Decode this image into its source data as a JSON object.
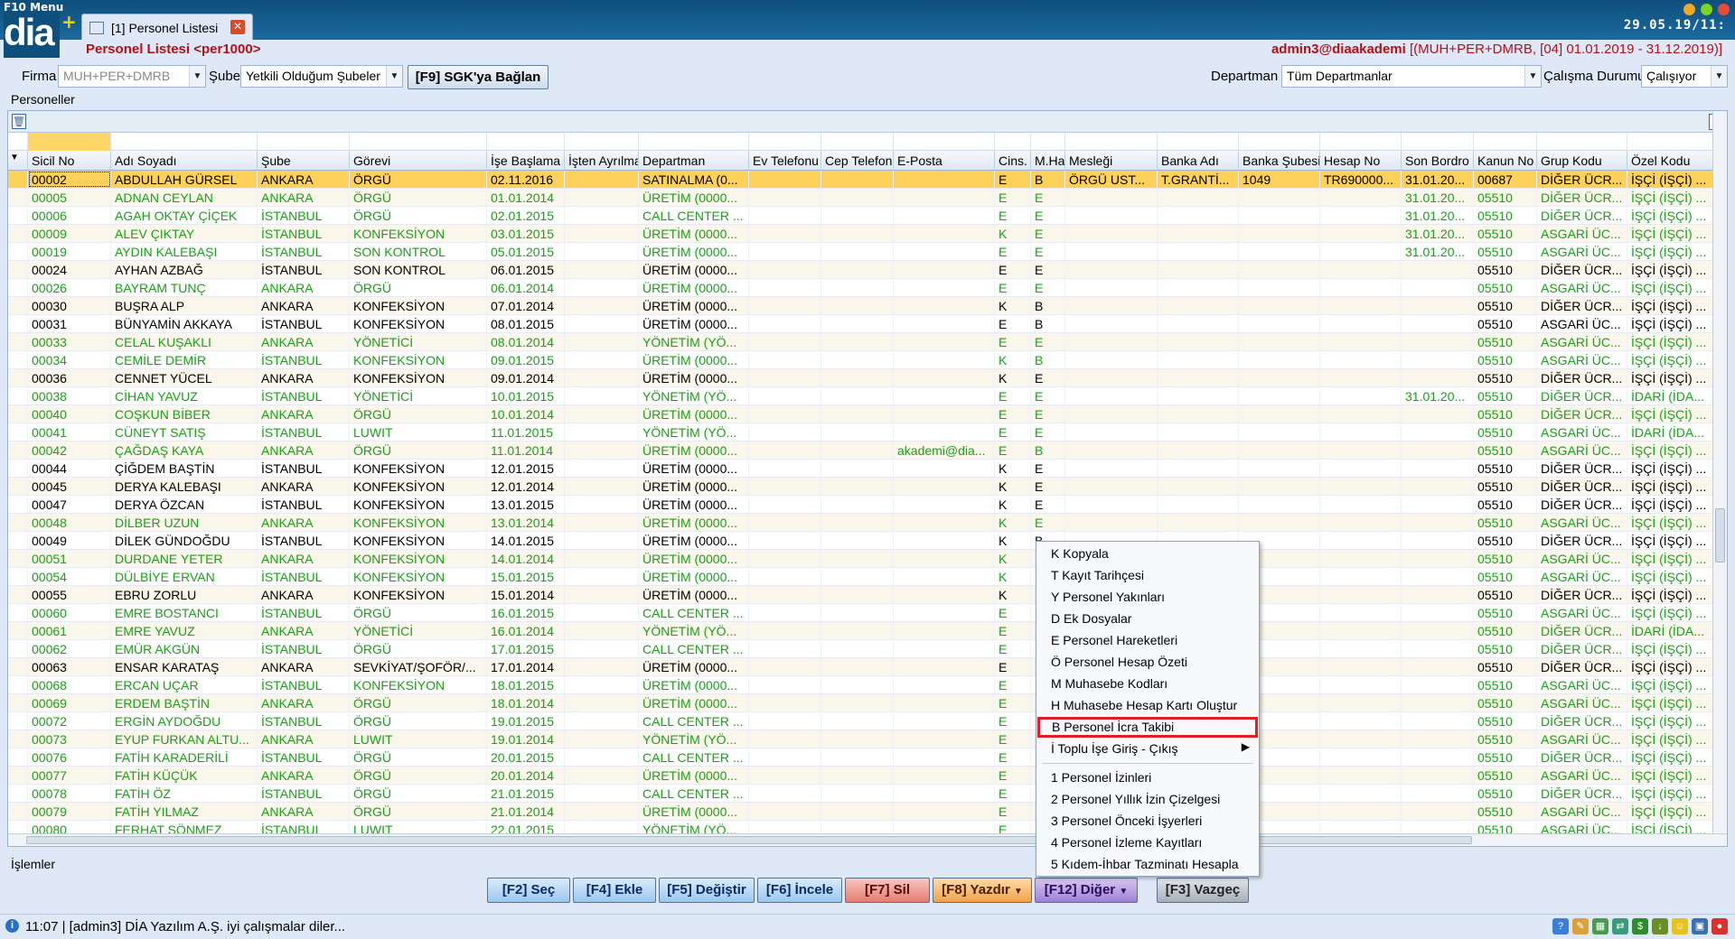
{
  "app": {
    "menu_label": "F10 Menu",
    "logo": "dia",
    "tab_label": "[1] Personel Listesi",
    "clock": "29.05.19/11:"
  },
  "title": {
    "left": "Personel Listesi <per1000>",
    "right_user": "admin3@diaakademi",
    "right_period": " [(MUH+PER+DMRB, [04] 01.01.2019 - 31.12.2019)]"
  },
  "filters": {
    "firma_label": "Firma",
    "firma_value": "MUH+PER+DMRB",
    "sube_label": "Şube",
    "sube_value": "Yetkili Olduğum Şubeler",
    "sgk_button": "[F9] SGK'ya Bağlan",
    "departman_label": "Departman",
    "departman_value": "Tüm Departmanlar",
    "calisma_label": "Çalışma Durumu",
    "calisma_value": "Çalışıyor"
  },
  "section_personeller": "Personeller",
  "section_islemler": "İşlemler",
  "columns": [
    "Sicil No",
    "Adı Soyadı",
    "Şube",
    "Görevi",
    "İşe Başlama",
    "İşten Ayrılma",
    "Departman",
    "Ev Telefonu",
    "Cep Telefonu",
    "E-Posta",
    "Cins.",
    "M.Hal",
    "Mesleği",
    "Banka Adı",
    "Banka Şubesi",
    "Hesap No",
    "Son Bordro",
    "Kanun No",
    "Grup Kodu",
    "Özel Kodu"
  ],
  "rows": [
    [
      "00002",
      "ABDULLAH GÜRSEL",
      "ANKARA",
      "ÖRGÜ",
      "02.11.2016",
      "",
      "SATINALMA (0...",
      "",
      "",
      "",
      "E",
      "B",
      "ÖRGÜ UST...",
      "T.GRANTİ...",
      "1049",
      "TR690000...",
      "31.01.20...",
      "00687",
      "DİĞER ÜCR...",
      "İŞÇİ (İŞÇİ) ...",
      "s"
    ],
    [
      "00005",
      "ADNAN CEYLAN",
      "ANKARA",
      "ÖRGÜ",
      "01.01.2014",
      "",
      "ÜRETİM (0000...",
      "",
      "",
      "",
      "E",
      "E",
      "",
      "",
      "",
      "",
      "31.01.20...",
      "05510",
      "DİĞER ÜCR...",
      "İŞÇİ (İŞÇİ) ...",
      "g"
    ],
    [
      "00006",
      "AGAH OKTAY ÇİÇEK",
      "İSTANBUL",
      "ÖRGÜ",
      "02.01.2015",
      "",
      "CALL CENTER ...",
      "",
      "",
      "",
      "E",
      "E",
      "",
      "",
      "",
      "",
      "31.01.20...",
      "05510",
      "DİĞER ÜCR...",
      "İŞÇİ (İŞÇİ) ...",
      "g"
    ],
    [
      "00009",
      "ALEV ÇIKTAY",
      "İSTANBUL",
      "KONFEKSİYON",
      "03.01.2015",
      "",
      "ÜRETİM (0000...",
      "",
      "",
      "",
      "K",
      "E",
      "",
      "",
      "",
      "",
      "31.01.20...",
      "05510",
      "ASGARİ ÜC...",
      "İŞÇİ (İŞÇİ) ...",
      "g"
    ],
    [
      "00019",
      "AYDIN KALEBAŞI",
      "İSTANBUL",
      "SON KONTROL",
      "05.01.2015",
      "",
      "ÜRETİM (0000...",
      "",
      "",
      "",
      "E",
      "E",
      "",
      "",
      "",
      "",
      "31.01.20...",
      "05510",
      "ASGARİ ÜC...",
      "İŞÇİ (İŞÇİ) ...",
      "g"
    ],
    [
      "00024",
      "AYHAN AZBAĞ",
      "İSTANBUL",
      "SON KONTROL",
      "06.01.2015",
      "",
      "ÜRETİM (0000...",
      "",
      "",
      "",
      "E",
      "E",
      "",
      "",
      "",
      "",
      "",
      "05510",
      "DİĞER ÜCR...",
      "İŞÇİ (İŞÇİ) ...",
      "b"
    ],
    [
      "00026",
      "BAYRAM TUNÇ",
      "ANKARA",
      "ÖRGÜ",
      "06.01.2014",
      "",
      "ÜRETİM (0000...",
      "",
      "",
      "",
      "E",
      "E",
      "",
      "",
      "",
      "",
      "",
      "05510",
      "ASGARİ ÜC...",
      "İŞÇİ (İŞÇİ) ...",
      "g"
    ],
    [
      "00030",
      "BUŞRA ALP",
      "ANKARA",
      "KONFEKSİYON",
      "07.01.2014",
      "",
      "ÜRETİM (0000...",
      "",
      "",
      "",
      "K",
      "B",
      "",
      "",
      "",
      "",
      "",
      "05510",
      "DİĞER ÜCR...",
      "İŞÇİ (İŞÇİ) ...",
      "b"
    ],
    [
      "00031",
      "BÜNYAMİN AKKAYA",
      "İSTANBUL",
      "KONFEKSİYON",
      "08.01.2015",
      "",
      "ÜRETİM (0000...",
      "",
      "",
      "",
      "E",
      "B",
      "",
      "",
      "",
      "",
      "",
      "05510",
      "ASGARİ ÜC...",
      "İŞÇİ (İŞÇİ) ...",
      "b"
    ],
    [
      "00033",
      "CELAL KUŞAKLI",
      "ANKARA",
      "YÖNETİCİ",
      "08.01.2014",
      "",
      "YÖNETİM (YÖ...",
      "",
      "",
      "",
      "E",
      "E",
      "",
      "",
      "",
      "",
      "",
      "05510",
      "ASGARİ ÜC...",
      "İŞÇİ (İŞÇİ) ...",
      "g"
    ],
    [
      "00034",
      "CEMİLE DEMİR",
      "İSTANBUL",
      "KONFEKSİYON",
      "09.01.2015",
      "",
      "ÜRETİM (0000...",
      "",
      "",
      "",
      "K",
      "B",
      "",
      "",
      "",
      "",
      "",
      "05510",
      "ASGARİ ÜC...",
      "İŞÇİ (İŞÇİ) ...",
      "g"
    ],
    [
      "00036",
      "CENNET YÜCEL",
      "ANKARA",
      "KONFEKSİYON",
      "09.01.2014",
      "",
      "ÜRETİM (0000...",
      "",
      "",
      "",
      "K",
      "E",
      "",
      "",
      "",
      "",
      "",
      "05510",
      "DİĞER ÜCR...",
      "İŞÇİ (İŞÇİ) ...",
      "b"
    ],
    [
      "00038",
      "CİHAN YAVUZ",
      "İSTANBUL",
      "YÖNETİCİ",
      "10.01.2015",
      "",
      "YÖNETİM (YÖ...",
      "",
      "",
      "",
      "E",
      "E",
      "",
      "",
      "",
      "",
      "31.01.20...",
      "05510",
      "DİĞER ÜCR...",
      "İDARİ (İDA...",
      "g"
    ],
    [
      "00040",
      "COŞKUN BİBER",
      "ANKARA",
      "ÖRGÜ",
      "10.01.2014",
      "",
      "ÜRETİM (0000...",
      "",
      "",
      "",
      "E",
      "E",
      "",
      "",
      "",
      "",
      "",
      "05510",
      "DİĞER ÜCR...",
      "İŞÇİ (İŞÇİ) ...",
      "g"
    ],
    [
      "00041",
      "CÜNEYT SATIŞ",
      "İSTANBUL",
      "LUWIT",
      "11.01.2015",
      "",
      "YÖNETİM (YÖ...",
      "",
      "",
      "",
      "E",
      "E",
      "",
      "",
      "",
      "",
      "",
      "05510",
      "ASGARİ ÜC...",
      "İDARİ (İDA...",
      "g"
    ],
    [
      "00042",
      "ÇAĞDAŞ KAYA",
      "ANKARA",
      "ÖRGÜ",
      "11.01.2014",
      "",
      "ÜRETİM (0000...",
      "",
      "",
      "akademi@dia...",
      "E",
      "B",
      "",
      "",
      "",
      "",
      "",
      "05510",
      "ASGARİ ÜC...",
      "İŞÇİ (İŞÇİ) ...",
      "g"
    ],
    [
      "00044",
      "ÇİĞDEM BAŞTİN",
      "İSTANBUL",
      "KONFEKSİYON",
      "12.01.2015",
      "",
      "ÜRETİM (0000...",
      "",
      "",
      "",
      "K",
      "E",
      "",
      "",
      "",
      "",
      "",
      "05510",
      "DİĞER ÜCR...",
      "İŞÇİ (İŞÇİ) ...",
      "b"
    ],
    [
      "00045",
      "DERYA KALEBAŞI",
      "ANKARA",
      "KONFEKSİYON",
      "12.01.2014",
      "",
      "ÜRETİM (0000...",
      "",
      "",
      "",
      "K",
      "E",
      "",
      "",
      "",
      "",
      "",
      "05510",
      "DİĞER ÜCR...",
      "İŞÇİ (İŞÇİ) ...",
      "b"
    ],
    [
      "00047",
      "DERYA ÖZCAN",
      "İSTANBUL",
      "KONFEKSİYON",
      "13.01.2015",
      "",
      "ÜRETİM (0000...",
      "",
      "",
      "",
      "K",
      "E",
      "",
      "",
      "",
      "",
      "",
      "05510",
      "DİĞER ÜCR...",
      "İŞÇİ (İŞÇİ) ...",
      "b"
    ],
    [
      "00048",
      "DİLBER UZUN",
      "ANKARA",
      "KONFEKSİYON",
      "13.01.2014",
      "",
      "ÜRETİM (0000...",
      "",
      "",
      "",
      "K",
      "E",
      "",
      "",
      "",
      "",
      "",
      "05510",
      "ASGARİ ÜC...",
      "İŞÇİ (İŞÇİ) ...",
      "g"
    ],
    [
      "00049",
      "DİLEK GÜNDOĞDU",
      "İSTANBUL",
      "KONFEKSİYON",
      "14.01.2015",
      "",
      "ÜRETİM (0000...",
      "",
      "",
      "",
      "K",
      "B",
      "",
      "",
      "",
      "",
      "",
      "05510",
      "DİĞER ÜCR...",
      "İŞÇİ (İŞÇİ) ...",
      "b"
    ],
    [
      "00051",
      "DURDANE YETER",
      "ANKARA",
      "KONFEKSİYON",
      "14.01.2014",
      "",
      "ÜRETİM (0000...",
      "",
      "",
      "",
      "K",
      "E",
      "",
      "",
      "",
      "",
      "",
      "05510",
      "ASGARİ ÜC...",
      "İŞÇİ (İŞÇİ) ...",
      "g"
    ],
    [
      "00054",
      "DÜLBİYE ERVAN",
      "İSTANBUL",
      "KONFEKSİYON",
      "15.01.2015",
      "",
      "ÜRETİM (0000...",
      "",
      "",
      "",
      "K",
      "B",
      "",
      "",
      "",
      "",
      "",
      "05510",
      "ASGARİ ÜC...",
      "İŞÇİ (İŞÇİ) ...",
      "g"
    ],
    [
      "00055",
      "EBRU ZORLU",
      "ANKARA",
      "KONFEKSİYON",
      "15.01.2014",
      "",
      "ÜRETİM (0000...",
      "",
      "",
      "",
      "K",
      "B",
      "",
      "",
      "",
      "",
      "",
      "05510",
      "DİĞER ÜCR...",
      "İŞÇİ (İŞÇİ) ...",
      "b"
    ],
    [
      "00060",
      "EMRE BOSTANCI",
      "İSTANBUL",
      "ÖRGÜ",
      "16.01.2015",
      "",
      "CALL CENTER ...",
      "",
      "",
      "",
      "E",
      "B",
      "",
      "",
      "",
      "",
      "",
      "05510",
      "ASGARİ ÜC...",
      "İŞÇİ (İŞÇİ) ...",
      "g"
    ],
    [
      "00061",
      "EMRE YAVUZ",
      "ANKARA",
      "YÖNETİCİ",
      "16.01.2014",
      "",
      "YÖNETİM (YÖ...",
      "",
      "",
      "",
      "E",
      "E",
      "",
      "",
      "",
      "",
      "",
      "05510",
      "DİĞER ÜCR...",
      "İDARİ (İDA...",
      "g"
    ],
    [
      "00062",
      "EMÜR AKGÜN",
      "İSTANBUL",
      "ÖRGÜ",
      "17.01.2015",
      "",
      "CALL CENTER ...",
      "",
      "",
      "",
      "E",
      "E",
      "",
      "",
      "",
      "",
      "",
      "05510",
      "DİĞER ÜCR...",
      "İŞÇİ (İŞÇİ) ...",
      "g"
    ],
    [
      "00063",
      "ENSAR KARATAŞ",
      "ANKARA",
      "SEVKİYAT/ŞOFÖR/...",
      "17.01.2014",
      "",
      "ÜRETİM (0000...",
      "",
      "",
      "",
      "E",
      "E",
      "",
      "",
      "",
      "",
      "",
      "05510",
      "DİĞER ÜCR...",
      "İŞÇİ (İŞÇİ) ...",
      "b"
    ],
    [
      "00068",
      "ERCAN UÇAR",
      "İSTANBUL",
      "KONFEKSİYON",
      "18.01.2015",
      "",
      "ÜRETİM (0000...",
      "",
      "",
      "",
      "E",
      "E",
      "",
      "",
      "",
      "",
      "",
      "05510",
      "ASGARİ ÜC...",
      "İŞÇİ (İŞÇİ) ...",
      "g"
    ],
    [
      "00069",
      "ERDEM BAŞTİN",
      "ANKARA",
      "ÖRGÜ",
      "18.01.2014",
      "",
      "ÜRETİM (0000...",
      "",
      "",
      "",
      "E",
      "B",
      "",
      "",
      "",
      "",
      "",
      "05510",
      "ASGARİ ÜC...",
      "İŞÇİ (İŞÇİ) ...",
      "g"
    ],
    [
      "00072",
      "ERGİN AYDOĞDU",
      "İSTANBUL",
      "ÖRGÜ",
      "19.01.2015",
      "",
      "CALL CENTER ...",
      "",
      "",
      "",
      "E",
      "B",
      "",
      "",
      "",
      "",
      "",
      "05510",
      "DİĞER ÜCR...",
      "İŞÇİ (İŞÇİ) ...",
      "g"
    ],
    [
      "00073",
      "EYUP FURKAN ALTU...",
      "ANKARA",
      "LUWIT",
      "19.01.2014",
      "",
      "YÖNETİM (YÖ...",
      "",
      "",
      "",
      "E",
      "E",
      "",
      "",
      "",
      "",
      "",
      "05510",
      "ASGARİ ÜC...",
      "İŞÇİ (İŞÇİ) ...",
      "g"
    ],
    [
      "00076",
      "FATİH KARADERİLİ",
      "İSTANBUL",
      "ÖRGÜ",
      "20.01.2015",
      "",
      "CALL CENTER ...",
      "",
      "",
      "",
      "E",
      "E",
      "",
      "",
      "",
      "",
      "",
      "05510",
      "DİĞER ÜCR...",
      "İŞÇİ (İŞÇİ) ...",
      "g"
    ],
    [
      "00077",
      "FATİH KÜÇÜK",
      "ANKARA",
      "ÖRGÜ",
      "20.01.2014",
      "",
      "ÜRETİM (0000...",
      "",
      "",
      "",
      "E",
      "E",
      "",
      "",
      "",
      "",
      "",
      "05510",
      "ASGARİ ÜC...",
      "İŞÇİ (İŞÇİ) ...",
      "g"
    ],
    [
      "00078",
      "FATİH ÖZ",
      "İSTANBUL",
      "ÖRGÜ",
      "21.01.2015",
      "",
      "CALL CENTER ...",
      "",
      "",
      "",
      "E",
      "B",
      "",
      "",
      "",
      "",
      "",
      "05510",
      "DİĞER ÜCR...",
      "İŞÇİ (İŞÇİ) ...",
      "g"
    ],
    [
      "00079",
      "FATİH YILMAZ",
      "ANKARA",
      "ÖRGÜ",
      "21.01.2014",
      "",
      "ÜRETİM (0000...",
      "",
      "",
      "",
      "E",
      "E",
      "",
      "",
      "",
      "",
      "",
      "05510",
      "ASGARİ ÜC...",
      "İŞÇİ (İŞÇİ) ...",
      "g"
    ],
    [
      "00080",
      "FERHAT SÖNMEZ",
      "İSTANBUL",
      "LUWIT",
      "22.01.2015",
      "",
      "YÖNETİM (YÖ...",
      "",
      "",
      "",
      "E",
      "E",
      "",
      "",
      "",
      "",
      "",
      "05510",
      "ASGARİ ÜC...",
      "İŞÇİ (İŞÇİ) ...",
      "g"
    ],
    [
      "00081",
      "FERYAT DEMİR",
      "ANKARA",
      "KONFEKSİYON",
      "22.01.2014",
      "",
      "ÜRETİM (0000...",
      "",
      "",
      "",
      "E",
      "B",
      "",
      "",
      "",
      "",
      "",
      "05510",
      "ASGARİ ÜC...",
      "İŞÇİ (İŞÇİ) ...",
      "g"
    ]
  ],
  "context_menu": [
    {
      "label": "K Kopyala"
    },
    {
      "label": "T Kayıt Tarihçesi"
    },
    {
      "label": "Y Personel Yakınları"
    },
    {
      "label": "D Ek Dosyalar"
    },
    {
      "label": "E Personel Hareketleri"
    },
    {
      "label": "Ö Personel Hesap Özeti"
    },
    {
      "label": "M Muhasebe Kodları"
    },
    {
      "label": "H Muhasebe Hesap Kartı Oluştur"
    },
    {
      "label": "B Personel İcra Takibi",
      "highlighted": true
    },
    {
      "label": "İ Toplu İşe Giriş - Çıkış",
      "submenu": true
    },
    {
      "label": "1 Personel İzinleri",
      "sep_before": true
    },
    {
      "label": "2 Personel Yıllık İzin Çizelgesi"
    },
    {
      "label": "3 Personel Önceki İşyerleri"
    },
    {
      "label": "4 Personel İzleme Kayıtları"
    },
    {
      "label": "5 Kıdem-İhbar Tazminatı Hesapla"
    }
  ],
  "actions": {
    "sec": "[F2] Seç",
    "ekle": "[F4] Ekle",
    "degistir": "[F5] Değiştir",
    "incele": "[F6] İncele",
    "sil": "[F7] Sil",
    "yazdir": "[F8] Yazdır",
    "diger": "[F12] Diğer",
    "vazgec": "[F3] Vazgeç"
  },
  "status": "11:07 | [admin3] DİA Yazılım A.Ş. iyi çalışmalar diler...",
  "colors": {
    "green_row": "#1aa01a",
    "selected_row": "#fdd15a",
    "highlight": "#e51c24"
  }
}
